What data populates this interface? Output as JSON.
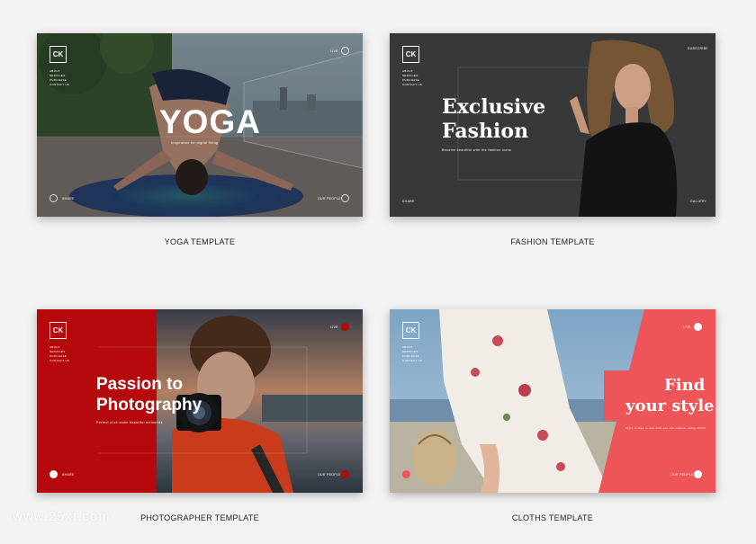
{
  "cards": {
    "yoga": {
      "logo": "CK",
      "title": "YOGA",
      "tagline": "Inspiration for digital living",
      "menu": [
        "ABOUT",
        "SERVICES",
        "PURCHASE",
        "CONTACT US"
      ],
      "top_right": "LIVE",
      "bottom_left": "SHARE",
      "bottom_right": "OUR PEOPLE",
      "caption": "YOGA TEMPLATE"
    },
    "fashion": {
      "logo": "CK",
      "title_line1": "Exclusive",
      "title_line2": "Fashion",
      "tagline": "Become beautiful with the fashion icons",
      "menu": [
        "ABOUT",
        "SERVICES",
        "PURCHASE",
        "CONTACT US"
      ],
      "top_right": "SUBSCRIBE",
      "bottom_left": "SHARE",
      "bottom_right": "GALLERY",
      "caption": "FASHION TEMPLATE"
    },
    "photographer": {
      "logo": "CK",
      "title_line1": "Passion to",
      "title_line2": "Photography",
      "tagline": "Perfect click make beautiful memories",
      "menu": [
        "ABOUT",
        "SERVICES",
        "PURCHASE",
        "CONTACT US"
      ],
      "top_right": "LIVE",
      "bottom_left": "SHARE",
      "bottom_right": "OUR PEOPLE",
      "caption": "PHOTOGRAPHER TEMPLATE"
    },
    "cloths": {
      "logo": "CK",
      "title_line1": "Find",
      "title_line2": "your style",
      "tagline": "Style is way to say who you are without using words",
      "menu": [
        "ABOUT",
        "SERVICES",
        "PURCHASE",
        "CONTACT US"
      ],
      "top_right": "LIVE",
      "bottom_left": "",
      "bottom_right": "OUR PEOPLE",
      "caption": "CLOTHS TEMPLATE"
    }
  },
  "watermark": "www.25xt.com",
  "colors": {
    "background": "#f3f3f3",
    "photographer_red": "#b5090b",
    "cloths_coral": "#ee5559",
    "fashion_dark": "#393b3e"
  }
}
